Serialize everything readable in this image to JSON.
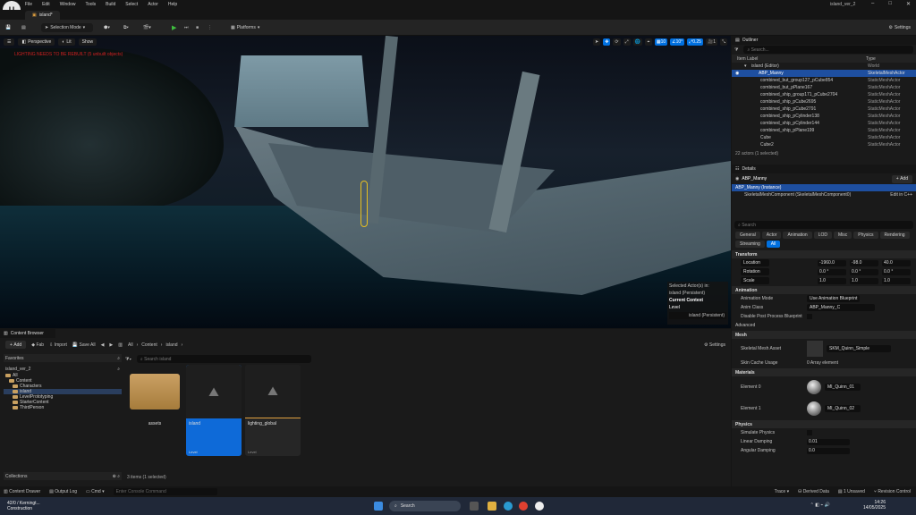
{
  "app": {
    "logo": "U",
    "project_name": "island_ver_2",
    "tab": "island*"
  },
  "menu": [
    "File",
    "Edit",
    "Window",
    "Tools",
    "Build",
    "Select",
    "Actor",
    "Help"
  ],
  "toolbar": {
    "selection_mode": "Selection Mode",
    "platforms": "Platforms",
    "settings": "Settings"
  },
  "viewport": {
    "perspective": "Perspective",
    "lit": "Lit",
    "show": "Show",
    "warning": "LIGHTING NEEDS TO BE REBUILT (5 unbuilt objects)",
    "grid_snap": "10",
    "rot_snap": "10°",
    "scale_snap": "0.25",
    "cam_speed": "1",
    "sel_title": "Selected Actor(s) in:",
    "sel_level": "island (Persistent)",
    "current_context": "Current Context",
    "level_label": "Level",
    "level_value": "island (Persistent)"
  },
  "outliner": {
    "title": "Outliner",
    "search_placeholder": "Search...",
    "col_label": "Item Label",
    "col_type": "Type",
    "rows": [
      {
        "label": "island (Editor)",
        "type": "World"
      },
      {
        "label": "ABP_Manny",
        "type": "SkeletalMeshActor"
      },
      {
        "label": "combined_but_group127_pCube854",
        "type": "StaticMeshActor"
      },
      {
        "label": "combined_but_pPlane167",
        "type": "StaticMeshActor"
      },
      {
        "label": "combined_ship_group171_pCube2704",
        "type": "StaticMeshActor"
      },
      {
        "label": "combined_ship_pCube2695",
        "type": "StaticMeshActor"
      },
      {
        "label": "combined_ship_pCube2791",
        "type": "StaticMeshActor"
      },
      {
        "label": "combined_ship_pCylinder138",
        "type": "StaticMeshActor"
      },
      {
        "label": "combined_ship_pCylinder144",
        "type": "StaticMeshActor"
      },
      {
        "label": "combined_ship_pPlane199",
        "type": "StaticMeshActor"
      },
      {
        "label": "Cube",
        "type": "StaticMeshActor"
      },
      {
        "label": "Cube2",
        "type": "StaticMeshActor"
      }
    ],
    "footer": "22 actors (1 selected)"
  },
  "details": {
    "title": "Details",
    "actor": "ABP_Manny",
    "add": "Add",
    "instance": "ABP_Manny (Instance)",
    "component": "SkeletalMeshComponent (SkeletalMeshComponent0)",
    "edit_in": "Edit in C++",
    "search_placeholder": "Search",
    "filters": [
      "General",
      "Actor",
      "Animation",
      "LOD",
      "Misc",
      "Physics",
      "Rendering",
      "Streaming",
      "All"
    ],
    "transform": "Transform",
    "location": {
      "label": "Location",
      "x": "-1960.0",
      "y": "-98.0",
      "z": "40.0"
    },
    "rotation": {
      "label": "Rotation",
      "x": "0.0 °",
      "y": "0.0 °",
      "z": "0.0 °"
    },
    "scale": {
      "label": "Scale",
      "x": "1.0",
      "y": "1.0",
      "z": "1.0"
    },
    "animation": "Animation",
    "anim_mode_label": "Animation Mode",
    "anim_mode": "Use Animation Blueprint",
    "anim_class_label": "Anim Class",
    "anim_class": "ABP_Manny_C",
    "post_process": "Disable Post Process Blueprint",
    "advanced": "Advanced",
    "mesh": "Mesh",
    "skel_mesh_label": "Skeletal Mesh Asset",
    "skel_mesh": "SKM_Quinn_Simple",
    "skin_cache_label": "Skin Cache Usage",
    "skin_cache": "0 Array element",
    "materials": "Materials",
    "el0_label": "Element 0",
    "el0": "MI_Quinn_01",
    "el1_label": "Element 1",
    "el1": "MI_Quinn_02",
    "physics": "Physics",
    "sim_label": "Simulate Physics",
    "lin_damp_label": "Linear Damping",
    "lin_damp": "0.01",
    "ang_damp_label": "Angular Damping",
    "ang_damp": "0.0"
  },
  "content_browser": {
    "title": "Content Browser",
    "add": "Add",
    "fab": "Fab",
    "import": "Import",
    "save_all": "Save All",
    "path": [
      "All",
      "Content",
      "island"
    ],
    "settings": "Settings",
    "favorites": "Favorites",
    "project": "island_ver_2",
    "tree": [
      "All",
      "Content",
      "Characters",
      "island",
      "LevelPrototyping",
      "StarterContent",
      "ThirdPerson"
    ],
    "collections": "Collections",
    "search_placeholder": "Search island",
    "assets": [
      {
        "name": "assets",
        "kind": ""
      },
      {
        "name": "island",
        "kind": "Level"
      },
      {
        "name": "lighting_global",
        "kind": "Level"
      }
    ],
    "count": "3 items (1 selected)"
  },
  "status": {
    "drawer": "Content Drawer",
    "output": "Output Log",
    "cmd": "Cmd",
    "console_placeholder": "Enter Console Command",
    "trace": "Trace",
    "derived": "Derived Data",
    "unsaved": "1 Unsaved",
    "revision": "Revision Control"
  },
  "taskbar": {
    "weather_temp": "42/0 / Kerningt...",
    "weather_desc": "Construction",
    "search": "Search",
    "time": "14:26",
    "date": "14/05/2025"
  }
}
